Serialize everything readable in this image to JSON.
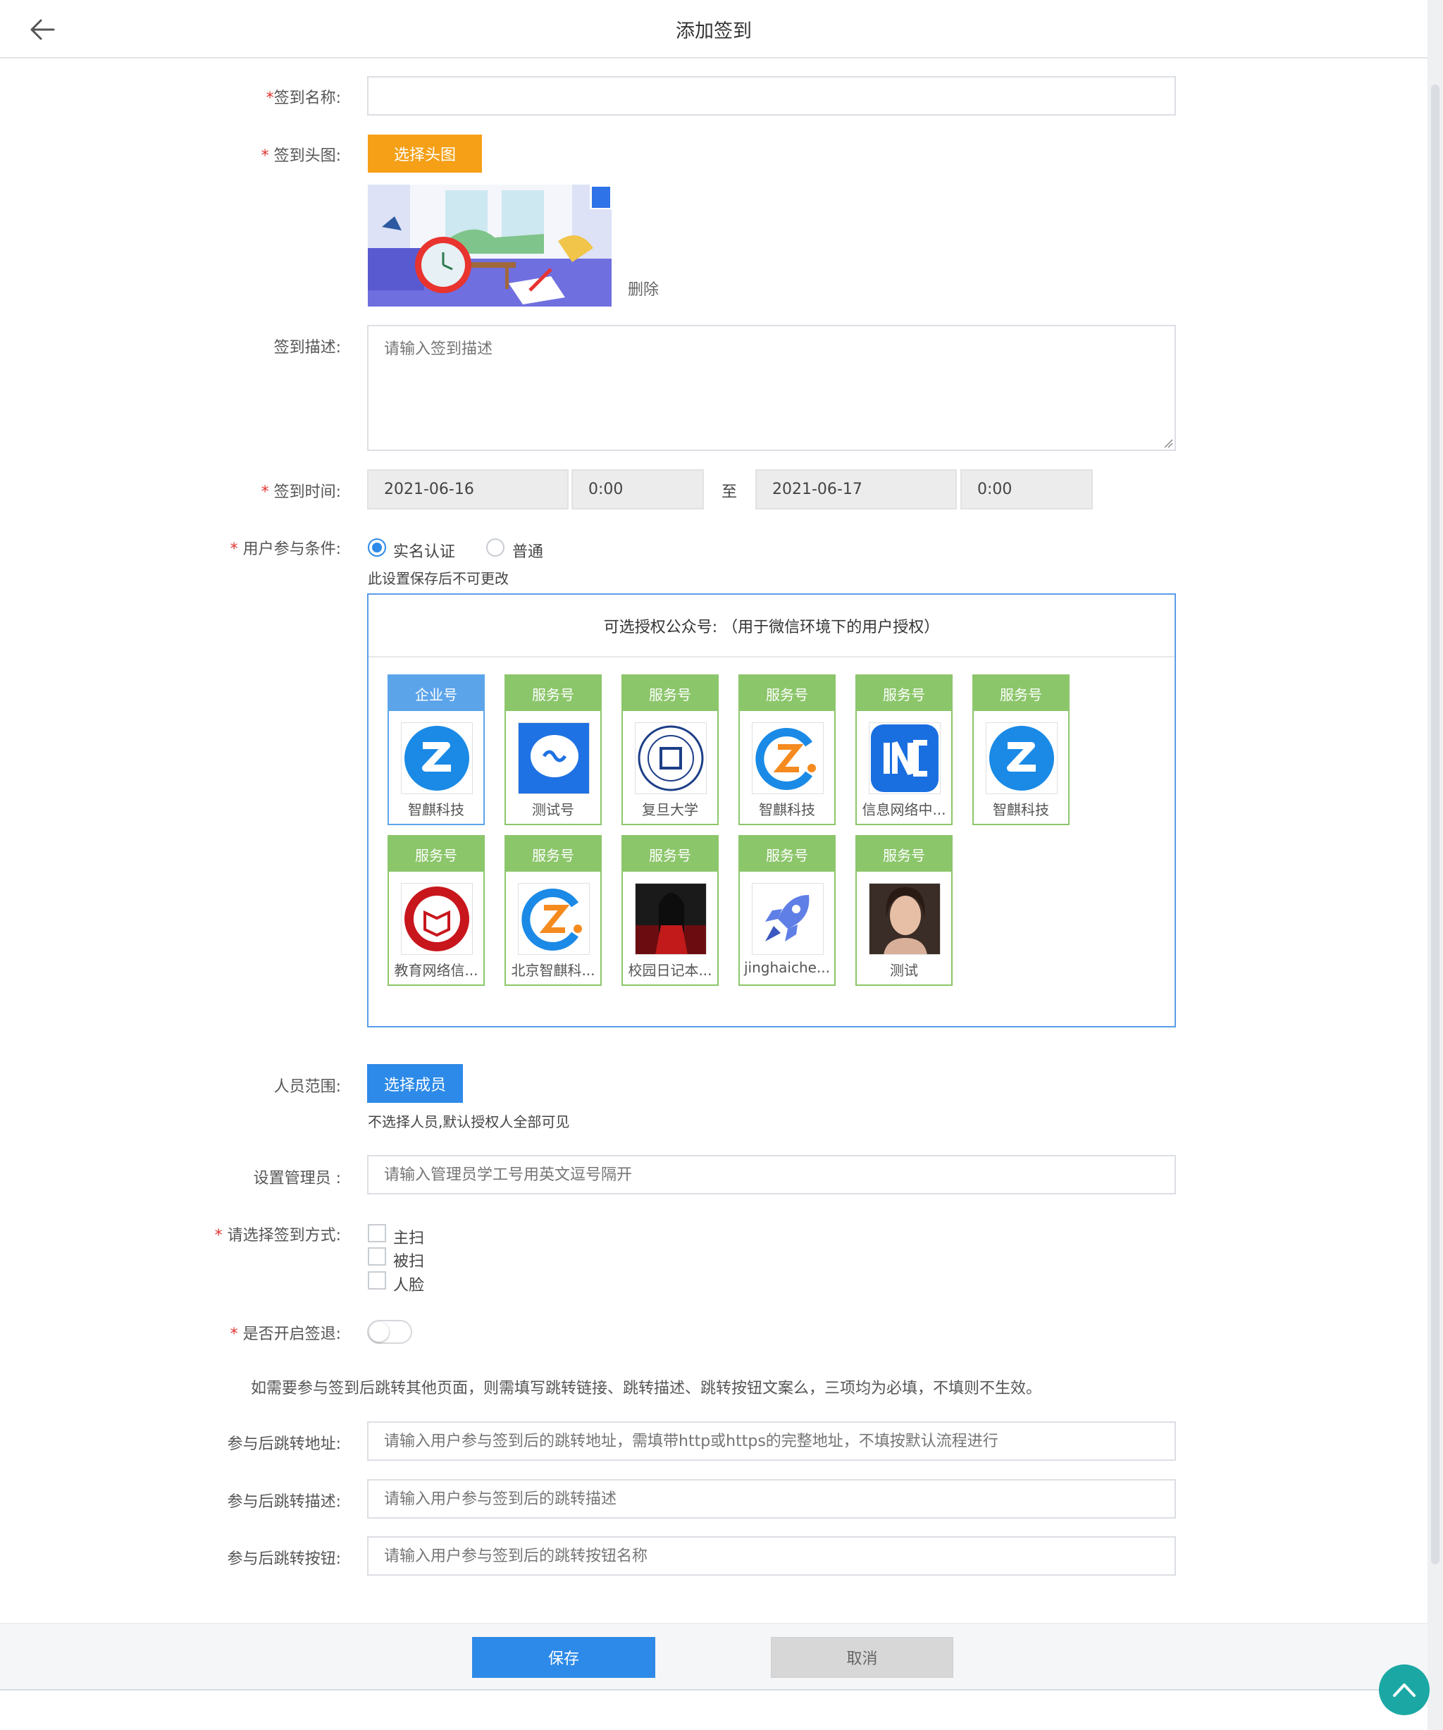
{
  "header": {
    "title": "添加签到"
  },
  "form": {
    "name": {
      "label": "签到名称:",
      "required": "*",
      "value": ""
    },
    "cover": {
      "label": "签到头图:",
      "required": "*",
      "button": "选择头图",
      "delete": "删除"
    },
    "desc": {
      "label": "签到描述:",
      "placeholder": "请输入签到描述"
    },
    "time": {
      "label": "签到时间:",
      "required": "*",
      "start_date": "2021-06-16",
      "start_time": "0:00",
      "to": "至",
      "end_date": "2021-06-17",
      "end_time": "0:00"
    },
    "condition": {
      "label": "用户参与条件:",
      "required": "*",
      "options": [
        "实名认证",
        "普通"
      ],
      "selected": "实名认证",
      "note": "此设置保存后不可更改"
    },
    "accounts": {
      "title": "可选授权公众号: （用于微信环境下的用户授权）",
      "items": [
        {
          "type": "企业号",
          "name": "智麒科技",
          "icon": "zhiqi-logo-icon"
        },
        {
          "type": "服务号",
          "name": "测试号",
          "icon": "infinity-chat-icon"
        },
        {
          "type": "服务号",
          "name": "复旦大学",
          "icon": "fudan-seal-icon"
        },
        {
          "type": "服务号",
          "name": "智麒科技",
          "icon": "zhiqi-z-logo-icon"
        },
        {
          "type": "服务号",
          "name": "信息网络中...",
          "icon": "inc-logo-icon"
        },
        {
          "type": "服务号",
          "name": "智麒科技",
          "icon": "zhiqi-logo-icon"
        },
        {
          "type": "服务号",
          "name": "教育网络信...",
          "icon": "edu-seal-icon"
        },
        {
          "type": "服务号",
          "name": "北京智麒科...",
          "icon": "zhiqi-z-logo-icon"
        },
        {
          "type": "服务号",
          "name": "校园日记本...",
          "icon": "person-photo-icon"
        },
        {
          "type": "服务号",
          "name": "jinghaiche...",
          "icon": "rocket-icon"
        },
        {
          "type": "服务号",
          "name": "测试",
          "icon": "portrait-photo-icon"
        }
      ]
    },
    "members": {
      "label": "人员范围:",
      "button": "选择成员",
      "note": "不选择人员,默认授权人全部可见"
    },
    "admin": {
      "label": "设置管理员 :",
      "placeholder": "请输入管理员学工号用英文逗号隔开"
    },
    "method": {
      "label": "请选择签到方式:",
      "required": "*",
      "options": [
        "主扫",
        "被扫",
        "人脸"
      ]
    },
    "checkout": {
      "label": "是否开启签退:",
      "required": "*",
      "enabled": false
    },
    "redirect_note": "如需要参与签到后跳转其他页面，则需填写跳转链接、跳转描述、跳转按钮文案么，三项均为必填，不填则不生效。",
    "redirect_url": {
      "label": "参与后跳转地址:",
      "placeholder": "请输入用户参与签到后的跳转地址，需填带http或https的完整地址，不填按默认流程进行"
    },
    "redirect_desc": {
      "label": "参与后跳转描述:",
      "placeholder": "请输入用户参与签到后的跳转描述"
    },
    "redirect_btn": {
      "label": "参与后跳转按钮:",
      "placeholder": "请输入用户参与签到后的跳转按钮名称"
    }
  },
  "footer": {
    "save": "保存",
    "cancel": "取消"
  },
  "colors": {
    "primary": "#2d8ae8",
    "orange": "#f5a017",
    "service_tag": "#8cc66b",
    "enterprise_tag": "#5ca4ea",
    "required": "#e0332f"
  }
}
